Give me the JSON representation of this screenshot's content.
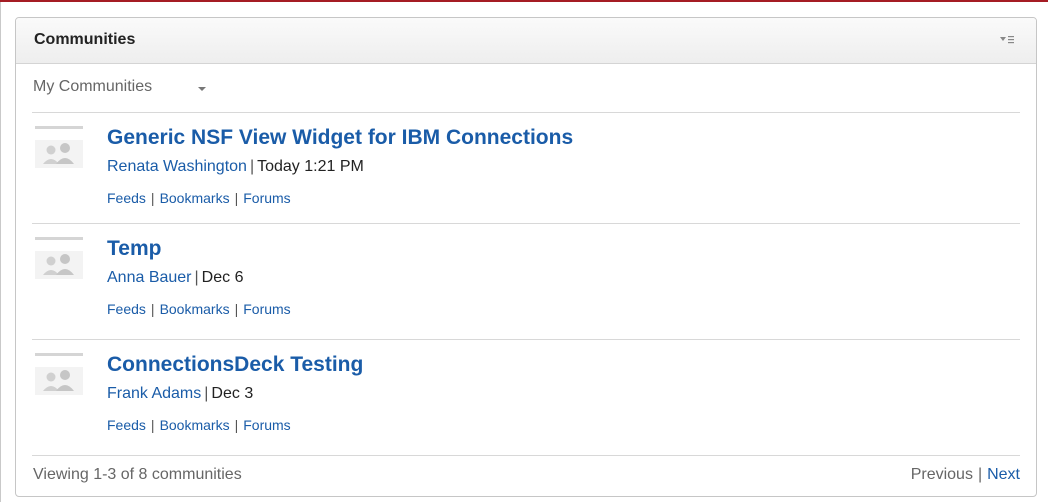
{
  "widget": {
    "title": "Communities",
    "menu_icon": "widget-menu-icon"
  },
  "filter": {
    "label": "My Communities",
    "icon": "chevron-down-icon"
  },
  "communities": [
    {
      "title": "Generic NSF View Widget for IBM Connections",
      "owner": "Renata Washington",
      "date": "Today 1:21 PM",
      "links": [
        "Feeds",
        "Bookmarks",
        "Forums"
      ]
    },
    {
      "title": "Temp",
      "owner": "Anna Bauer",
      "date": "Dec 6",
      "links": [
        "Feeds",
        "Bookmarks",
        "Forums"
      ]
    },
    {
      "title": "ConnectionsDeck Testing",
      "owner": "Frank Adams",
      "date": "Dec 3",
      "links": [
        "Feeds",
        "Bookmarks",
        "Forums"
      ]
    }
  ],
  "footer": {
    "status": "Viewing 1-3 of 8 communities",
    "previous_label": "Previous",
    "next_label": "Next"
  },
  "colors": {
    "link": "#1a5ca8",
    "top_strip": "#a51c24"
  }
}
